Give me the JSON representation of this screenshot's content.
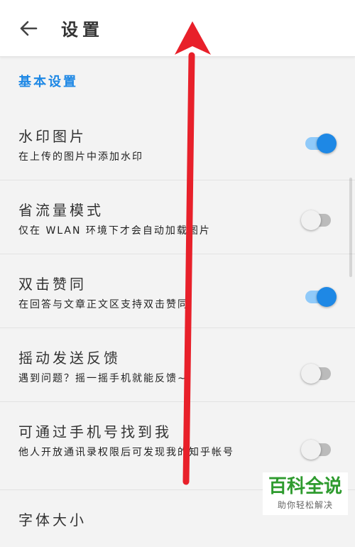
{
  "appbar": {
    "title": "设置"
  },
  "section": {
    "header": "基本设置"
  },
  "settings": [
    {
      "title": "水印图片",
      "desc": "在上传的图片中添加水印",
      "enabled": true
    },
    {
      "title": "省流量模式",
      "desc": "仅在 WLAN 环境下才会自动加载图片",
      "enabled": false
    },
    {
      "title": "双击赞同",
      "desc": "在回答与文章正文区支持双击赞同",
      "enabled": true
    },
    {
      "title": "摇动发送反馈",
      "desc": "遇到问题？摇一摇手机就能反馈~",
      "enabled": false
    },
    {
      "title": "可通过手机号找到我",
      "desc": "他人开放通讯录权限后可发现我的知乎帐号",
      "enabled": false
    },
    {
      "title": "字体大小",
      "desc": "",
      "enabled": null
    }
  ],
  "watermark": {
    "main": "百科全说",
    "sub": "助你轻松解决"
  },
  "colors": {
    "accent": "#1e88e5",
    "annotation_arrow": "#e8202a",
    "watermark_green": "#2e9b2e"
  }
}
